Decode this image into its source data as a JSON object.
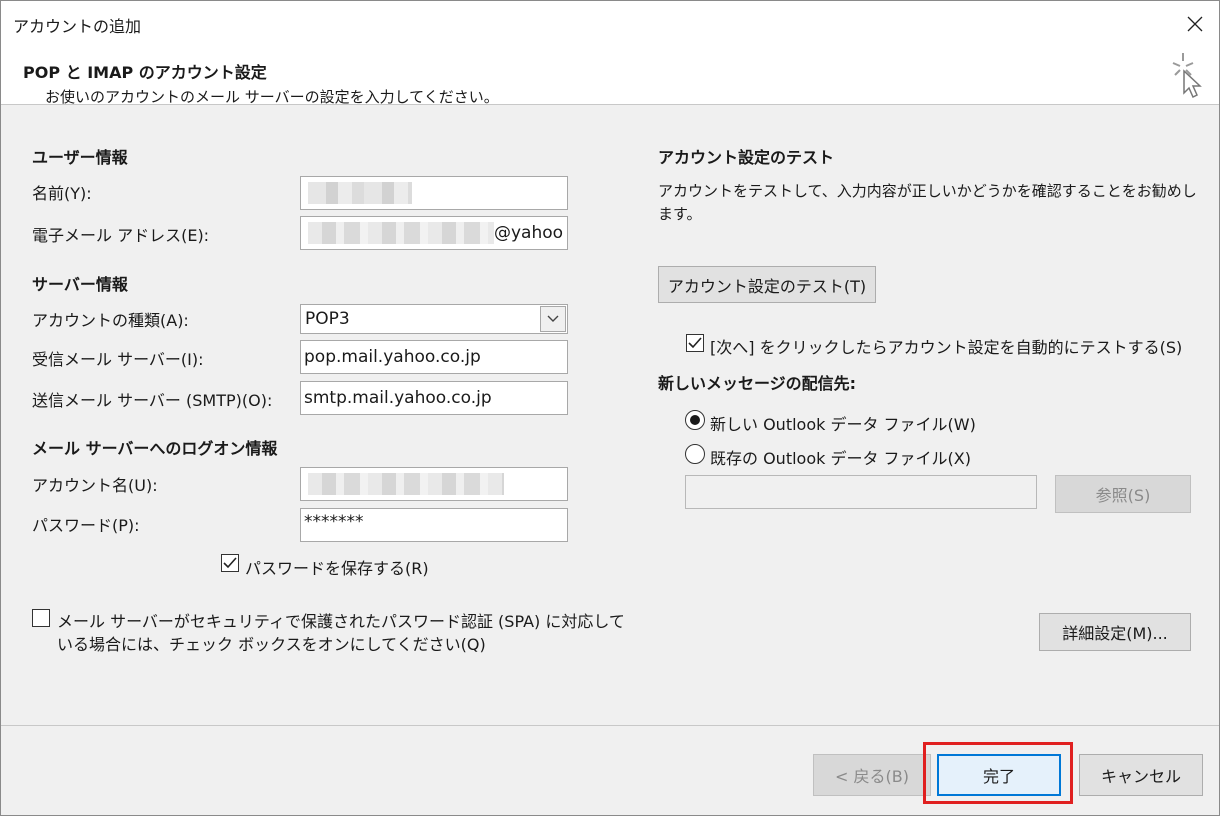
{
  "window": {
    "title": "アカウントの追加"
  },
  "header": {
    "title": "POP と IMAP のアカウント設定",
    "subtitle": "お使いのアカウントのメール サーバーの設定を入力してください。"
  },
  "user_info": {
    "section": "ユーザー情報",
    "name_label": "名前(Y):",
    "email_label": "電子メール アドレス(E):",
    "email_suffix": "@yahoo"
  },
  "server_info": {
    "section": "サーバー情報",
    "account_type_label": "アカウントの種類(A):",
    "account_type_value": "POP3",
    "incoming_label": "受信メール サーバー(I):",
    "incoming_value": "pop.mail.yahoo.co.jp",
    "outgoing_label": "送信メール サーバー (SMTP)(O):",
    "outgoing_value": "smtp.mail.yahoo.co.jp"
  },
  "logon_info": {
    "section": "メール サーバーへのログオン情報",
    "account_name_label": "アカウント名(U):",
    "password_label": "パスワード(P):",
    "password_value": "*******",
    "save_password_label": "パスワードを保存する(R)",
    "save_password_checked": true,
    "spa_label_line1": "メール サーバーがセキュリティで保護されたパスワード認証 (SPA) に対応して",
    "spa_label_line2": "いる場合には、チェック ボックスをオンにしてください(Q)",
    "spa_checked": false
  },
  "test": {
    "section": "アカウント設定のテスト",
    "description_line1": "アカウントをテストして、入力内容が正しいかどうかを確認することをお勧めし",
    "description_line2": "ます。",
    "test_button": "アカウント設定のテスト(T)",
    "auto_test_label": "[次へ] をクリックしたらアカウント設定を自動的にテストする(S)",
    "auto_test_checked": true
  },
  "delivery": {
    "section": "新しいメッセージの配信先:",
    "option_new": "新しい Outlook データ ファイル(W)",
    "option_existing": "既存の Outlook データ ファイル(X)",
    "selected": "new",
    "browse_button": "参照(S)"
  },
  "buttons": {
    "more_settings": "詳細設定(M)...",
    "back": "< 戻る(B)",
    "finish": "完了",
    "cancel": "キャンセル"
  },
  "colors": {
    "highlight": "#e02020",
    "focus": "#0078d7"
  }
}
